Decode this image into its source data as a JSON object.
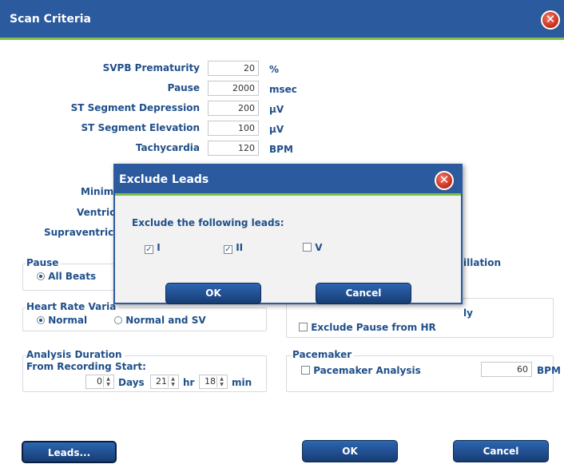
{
  "window": {
    "title": "Scan Criteria"
  },
  "criteria": {
    "svpb": {
      "label": "SVPB Prematurity",
      "value": "20",
      "unit": "%"
    },
    "pause": {
      "label": "Pause",
      "value": "2000",
      "unit": "msec"
    },
    "st_dep": {
      "label": "ST Segment Depression",
      "value": "200",
      "unit": "µV"
    },
    "st_elev": {
      "label": "ST Segment Elevation",
      "value": "100",
      "unit": "µV"
    },
    "tachy": {
      "label": "Tachycardia",
      "value": "120",
      "unit": "BPM"
    },
    "partial": {
      "minimum": "Minim",
      "ventricular": "Ventric",
      "supraventricular": "Supraventric"
    }
  },
  "pause_group": {
    "title": "Pause",
    "option": "All Beats",
    "partial_right": "illation"
  },
  "hrv_group": {
    "title": "Heart Rate Varia",
    "opt_normal": "Normal",
    "opt_other": "Normal and SV"
  },
  "hr_group": {
    "partial": "ly",
    "exclude_pause": "Exclude Pause from HR"
  },
  "duration": {
    "title": "Analysis Duration",
    "subtitle": "From Recording Start:",
    "days": "0",
    "days_unit": "Days",
    "hr": "21",
    "hr_unit": "hr",
    "min": "18",
    "min_unit": "min"
  },
  "pacemaker": {
    "title": "Pacemaker",
    "checkbox": "Pacemaker Analysis",
    "value": "60",
    "unit": "BPM"
  },
  "buttons": {
    "leads": "Leads...",
    "ok": "OK",
    "cancel": "Cancel"
  },
  "dialog": {
    "title": "Exclude Leads",
    "instruction": "Exclude the following leads:",
    "leads": [
      {
        "name": "I",
        "checked": true
      },
      {
        "name": "II",
        "checked": true
      },
      {
        "name": "V",
        "checked": false
      }
    ],
    "ok": "OK",
    "cancel": "Cancel"
  },
  "colors": {
    "titlebar": "#2b5a9e",
    "accent": "#7dc242",
    "text": "#1f4f8a",
    "close": "#c42b1c"
  }
}
